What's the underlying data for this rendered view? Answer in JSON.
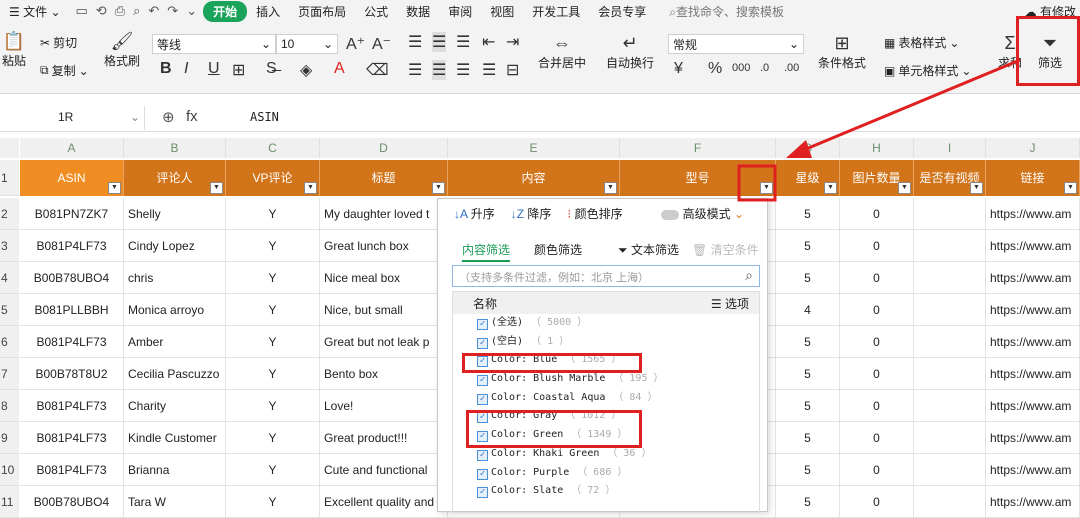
{
  "menubar": {
    "file": "文件",
    "tabs": [
      "开始",
      "插入",
      "页面布局",
      "公式",
      "数据",
      "审阅",
      "视图",
      "开发工具",
      "会员专享"
    ],
    "search": "查找命令、搜索模板",
    "right": "有修改"
  },
  "ribbon": {
    "paste": "粘贴",
    "cut": "剪切",
    "copy": "复制",
    "format_painter": "格式刷",
    "font": "等线",
    "size": "10",
    "merge": "合并居中",
    "wrap": "自动换行",
    "number_format": "常规",
    "cond_format": "条件格式",
    "table_style": "表格样式",
    "cell_style": "单元格样式",
    "sum": "求和",
    "filter": "筛选"
  },
  "formula_bar": {
    "name_box": "1R",
    "fx": "fx",
    "value": "ASIN"
  },
  "columns": [
    "A",
    "B",
    "C",
    "D",
    "E",
    "F",
    "G",
    "H",
    "I",
    "J"
  ],
  "header_row": {
    "num": "1",
    "cells": [
      "ASIN",
      "评论人",
      "VP评论",
      "标题",
      "内容",
      "型号",
      "星级",
      "图片数量",
      "是否有视频",
      "链接"
    ]
  },
  "rows": [
    {
      "num": "2",
      "asin": "B081PN7ZK7",
      "reviewer": "Shelly",
      "vp": "Y",
      "title": "My daughter loved t",
      "stars": "5",
      "images": "0",
      "link": "https://www.am"
    },
    {
      "num": "3",
      "asin": "B081P4LF73",
      "reviewer": "Cindy Lopez",
      "vp": "Y",
      "title": "Great lunch box",
      "stars": "5",
      "images": "0",
      "link": "https://www.am"
    },
    {
      "num": "4",
      "asin": "B00B78UBO4",
      "reviewer": "chris",
      "vp": "Y",
      "title": "Nice meal box",
      "stars": "5",
      "images": "0",
      "link": "https://www.am"
    },
    {
      "num": "5",
      "asin": "B081PLLBBH",
      "reviewer": "Monica arroyo",
      "vp": "Y",
      "title": "Nice, but small",
      "stars": "4",
      "images": "0",
      "link": "https://www.am"
    },
    {
      "num": "6",
      "asin": "B081P4LF73",
      "reviewer": "Amber",
      "vp": "Y",
      "title": "Great but not leak p",
      "stars": "5",
      "images": "0",
      "link": "https://www.am"
    },
    {
      "num": "7",
      "asin": "B00B78T8U2",
      "reviewer": "Cecilia Pascuzzo",
      "vp": "Y",
      "title": "Bento box",
      "stars": "5",
      "images": "0",
      "link": "https://www.am"
    },
    {
      "num": "8",
      "asin": "B081P4LF73",
      "reviewer": "Charity",
      "vp": "Y",
      "title": "Love!",
      "stars": "5",
      "images": "0",
      "link": "https://www.am"
    },
    {
      "num": "9",
      "asin": "B081P4LF73",
      "reviewer": "Kindle Customer",
      "vp": "Y",
      "title": "Great product!!!",
      "stars": "5",
      "images": "0",
      "link": "https://www.am"
    },
    {
      "num": "10",
      "asin": "B081P4LF73",
      "reviewer": "Brianna",
      "vp": "Y",
      "title": "Cute and functional",
      "stars": "5",
      "images": "0",
      "link": "https://www.am"
    },
    {
      "num": "11",
      "asin": "B00B78UBO4",
      "reviewer": "Tara W",
      "vp": "Y",
      "title": "Excellent quality and",
      "stars": "5",
      "images": "0",
      "link": "https://www.am"
    }
  ],
  "filter_panel": {
    "asc": "升序",
    "desc": "降序",
    "color_sort": "颜色排序",
    "advanced": "高级模式",
    "tab_content": "内容筛选",
    "tab_color": "颜色筛选",
    "text_filter": "文本筛选",
    "clear": "清空条件",
    "search_placeholder": "（支持多条件过滤，例如：北京 上海）",
    "list_header": "名称",
    "options": "选项",
    "items": [
      {
        "label": "(全选)",
        "count": "（ 5000 ）"
      },
      {
        "label": "(空白)",
        "count": "（ 1 ）"
      },
      {
        "label": "Color: Blue",
        "count": "（ 1565 ）"
      },
      {
        "label": "Color: Blush Marble",
        "count": "（ 195 ）"
      },
      {
        "label": "Color: Coastal Aqua",
        "count": "（ 84 ）"
      },
      {
        "label": "Color: Gray",
        "count": "（ 1012 ）"
      },
      {
        "label": "Color: Green",
        "count": "（ 1349 ）"
      },
      {
        "label": "Color: Khaki Green",
        "count": "（ 36 ）"
      },
      {
        "label": "Color: Purple",
        "count": "（ 686 ）"
      },
      {
        "label": "Color: Slate",
        "count": "（ 72 ）"
      }
    ]
  },
  "colors": {
    "header_orange": "#d1741a",
    "header_first": "#f08d22",
    "accent_green": "#1aa35a",
    "highlight_red": "#e02020"
  }
}
